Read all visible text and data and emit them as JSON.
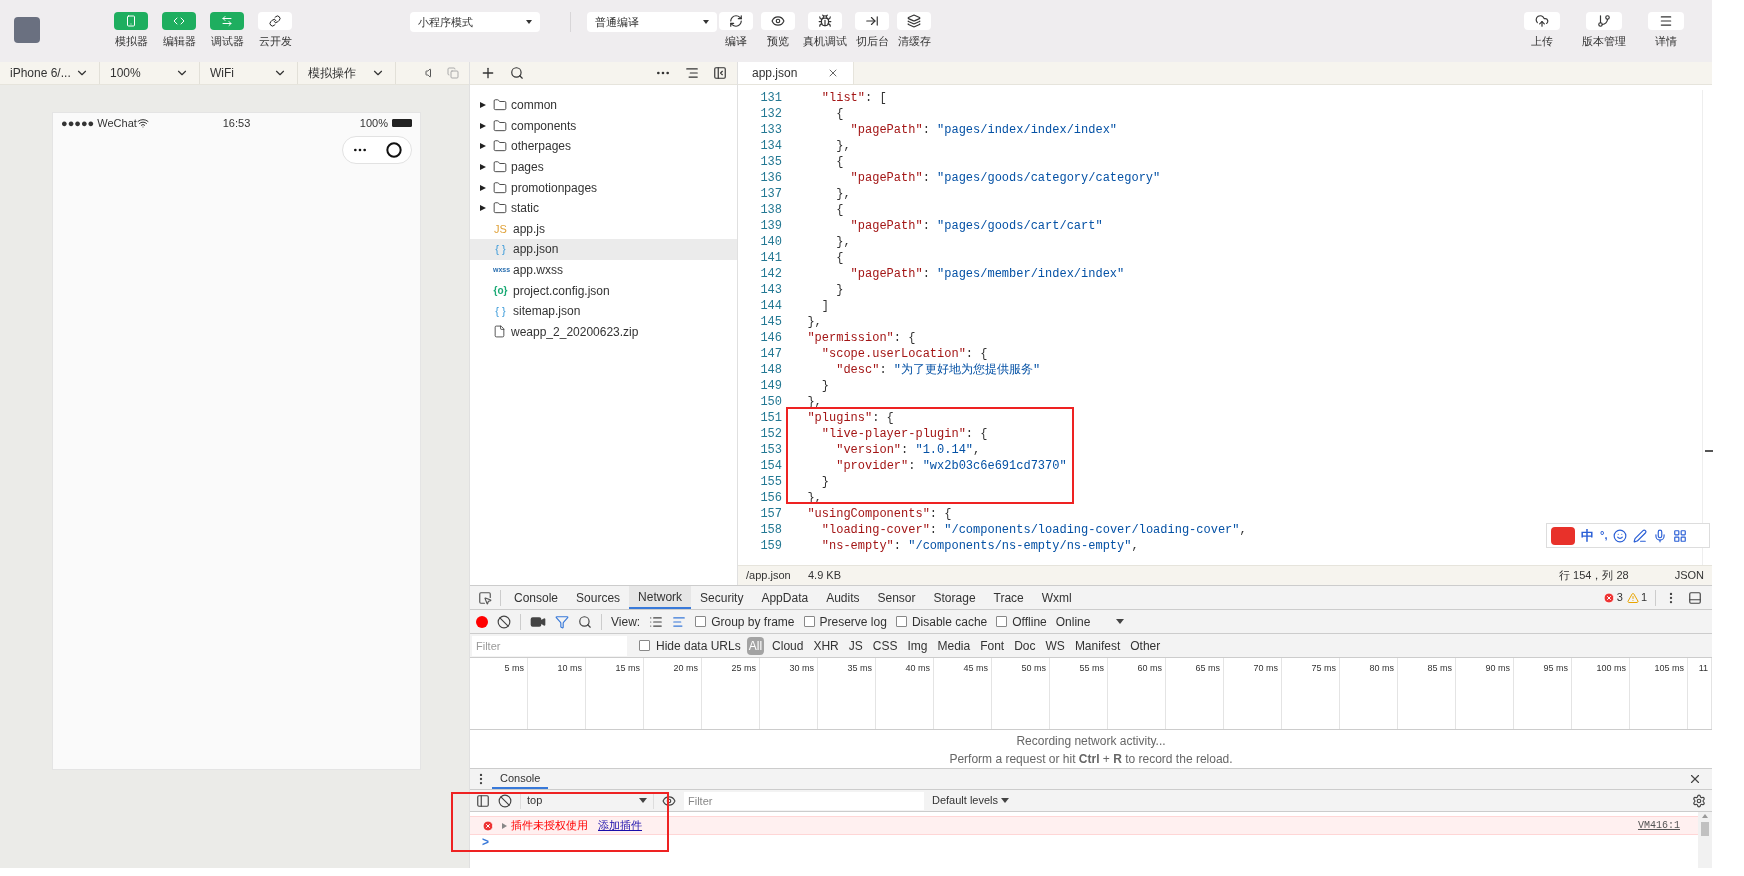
{
  "toolbar": {
    "mode_buttons": [
      {
        "label": "模拟器",
        "kind": "phone",
        "selected": true
      },
      {
        "label": "编辑器",
        "kind": "code",
        "selected": true
      },
      {
        "label": "调试器",
        "kind": "debug",
        "selected": true
      },
      {
        "label": "云开发",
        "kind": "cloud",
        "selected": false
      }
    ],
    "mode_select": "小程序模式",
    "compile_select": "普通编译",
    "actions": [
      {
        "label": "编译",
        "kind": "refresh"
      },
      {
        "label": "预览",
        "kind": "eye"
      },
      {
        "label": "真机调试",
        "kind": "bug"
      },
      {
        "label": "切后台",
        "kind": "background"
      },
      {
        "label": "清缓存",
        "kind": "layers"
      }
    ],
    "right_actions": [
      {
        "label": "上传",
        "kind": "upload"
      },
      {
        "label": "版本管理",
        "kind": "branch"
      },
      {
        "label": "详情",
        "kind": "menu"
      }
    ]
  },
  "simulator_bar": {
    "device": "iPhone 6/...",
    "zoom": "100%",
    "network": "WiFi",
    "operation": "模拟操作"
  },
  "phone": {
    "carrier": "●●●●● WeChat",
    "time": "16:53",
    "battery": "100%"
  },
  "file_tree": {
    "items": [
      {
        "name": "common",
        "kind": "folder",
        "expanded": false,
        "selected": false
      },
      {
        "name": "components",
        "kind": "folder",
        "expanded": false,
        "selected": false
      },
      {
        "name": "otherpages",
        "kind": "folder",
        "expanded": false,
        "selected": false
      },
      {
        "name": "pages",
        "kind": "folder",
        "expanded": false,
        "selected": false
      },
      {
        "name": "promotionpages",
        "kind": "folder",
        "expanded": false,
        "selected": false
      },
      {
        "name": "static",
        "kind": "folder",
        "expanded": false,
        "selected": false
      },
      {
        "name": "app.js",
        "kind": "js",
        "icon_text": "JS",
        "selected": false
      },
      {
        "name": "app.json",
        "kind": "json",
        "icon_text": "{ }",
        "selected": true
      },
      {
        "name": "app.wxss",
        "kind": "wxss",
        "icon_text": "wxss",
        "selected": false
      },
      {
        "name": "project.config.json",
        "kind": "config",
        "icon_text": "{o}",
        "selected": false
      },
      {
        "name": "sitemap.json",
        "kind": "json",
        "icon_text": "{ }",
        "selected": false
      },
      {
        "name": "weapp_2_20200623.zip",
        "kind": "file",
        "selected": false
      }
    ]
  },
  "editor": {
    "tab": "app.json",
    "lines": [
      {
        "number": "131",
        "text": "    \"list\": ["
      },
      {
        "number": "132",
        "text": "      {"
      },
      {
        "number": "133",
        "text": "        \"pagePath\": \"pages/index/index/index\""
      },
      {
        "number": "134",
        "text": "      },"
      },
      {
        "number": "135",
        "text": "      {"
      },
      {
        "number": "136",
        "text": "        \"pagePath\": \"pages/goods/category/category\""
      },
      {
        "number": "137",
        "text": "      },"
      },
      {
        "number": "138",
        "text": "      {"
      },
      {
        "number": "139",
        "text": "        \"pagePath\": \"pages/goods/cart/cart\""
      },
      {
        "number": "140",
        "text": "      },"
      },
      {
        "number": "141",
        "text": "      {"
      },
      {
        "number": "142",
        "text": "        \"pagePath\": \"pages/member/index/index\""
      },
      {
        "number": "143",
        "text": "      }"
      },
      {
        "number": "144",
        "text": "    ]"
      },
      {
        "number": "145",
        "text": "  },"
      },
      {
        "number": "146",
        "text": "  \"permission\": {"
      },
      {
        "number": "147",
        "text": "    \"scope.userLocation\": {"
      },
      {
        "number": "148",
        "text": "      \"desc\": \"为了更好地为您提供服务\""
      },
      {
        "number": "149",
        "text": "    }"
      },
      {
        "number": "150",
        "text": "  },"
      },
      {
        "number": "151",
        "text": "  \"plugins\": {"
      },
      {
        "number": "152",
        "text": "    \"live-player-plugin\": {"
      },
      {
        "number": "153",
        "text": "      \"version\": \"1.0.14\","
      },
      {
        "number": "154",
        "text": "      \"provider\": \"wx2b03c6e691cd7370\""
      },
      {
        "number": "155",
        "text": "    }"
      },
      {
        "number": "156",
        "text": "  },"
      },
      {
        "number": "157",
        "text": "  \"usingComponents\": {"
      },
      {
        "number": "158",
        "text": "    \"loading-cover\": \"/components/loading-cover/loading-cover\","
      },
      {
        "number": "159",
        "text": "    \"ns-empty\": \"/components/ns-empty/ns-empty\","
      }
    ],
    "status": {
      "path": "/app.json",
      "size": "4.9 KB",
      "position": "行 154，列 28",
      "language": "JSON"
    }
  },
  "ime": {
    "lang": "中",
    "punct": "°,"
  },
  "devtools": {
    "tabs": [
      {
        "label": "Console",
        "selected": false
      },
      {
        "label": "Sources",
        "selected": false
      },
      {
        "label": "Network",
        "selected": true
      },
      {
        "label": "Security",
        "selected": false
      },
      {
        "label": "AppData",
        "selected": false
      },
      {
        "label": "Audits",
        "selected": false
      },
      {
        "label": "Sensor",
        "selected": false
      },
      {
        "label": "Storage",
        "selected": false
      },
      {
        "label": "Trace",
        "selected": false
      },
      {
        "label": "Wxml",
        "selected": false
      }
    ],
    "errors": "3",
    "warnings": "1",
    "recording": true,
    "view_label": "View:",
    "options": [
      {
        "label": "Group by frame",
        "checked": false
      },
      {
        "label": "Preserve log",
        "checked": false
      },
      {
        "label": "Disable cache",
        "checked": false
      },
      {
        "label": "Offline",
        "checked": false
      }
    ],
    "throttle": "Online",
    "filter_placeholder": "Filter",
    "hide_data_urls": {
      "label": "Hide data URLs",
      "checked": false
    },
    "types": [
      {
        "label": "All",
        "selected": true
      },
      {
        "label": "Cloud",
        "selected": false
      },
      {
        "label": "XHR",
        "selected": false
      },
      {
        "label": "JS",
        "selected": false
      },
      {
        "label": "CSS",
        "selected": false
      },
      {
        "label": "Img",
        "selected": false
      },
      {
        "label": "Media",
        "selected": false
      },
      {
        "label": "Font",
        "selected": false
      },
      {
        "label": "Doc",
        "selected": false
      },
      {
        "label": "WS",
        "selected": false
      },
      {
        "label": "Manifest",
        "selected": false
      },
      {
        "label": "Other",
        "selected": false
      }
    ],
    "ticks": [
      "5 ms",
      "10 ms",
      "15 ms",
      "20 ms",
      "25 ms",
      "30 ms",
      "35 ms",
      "40 ms",
      "45 ms",
      "50 ms",
      "55 ms",
      "60 ms",
      "65 ms",
      "70 ms",
      "75 ms",
      "80 ms",
      "85 ms",
      "90 ms",
      "95 ms",
      "100 ms",
      "105 ms",
      "11"
    ],
    "messages": [
      "Recording network activity...",
      "Perform a request or hit **Ctrl** + **R** to record the reload."
    ]
  },
  "console": {
    "tab": "Console",
    "context": "top",
    "filter_placeholder": "Filter",
    "levels": "Default levels",
    "messages": [
      {
        "kind": "error",
        "text": "插件未授权使用",
        "link": "添加插件",
        "source": "VM416:1"
      }
    ],
    "prompt": ">"
  }
}
